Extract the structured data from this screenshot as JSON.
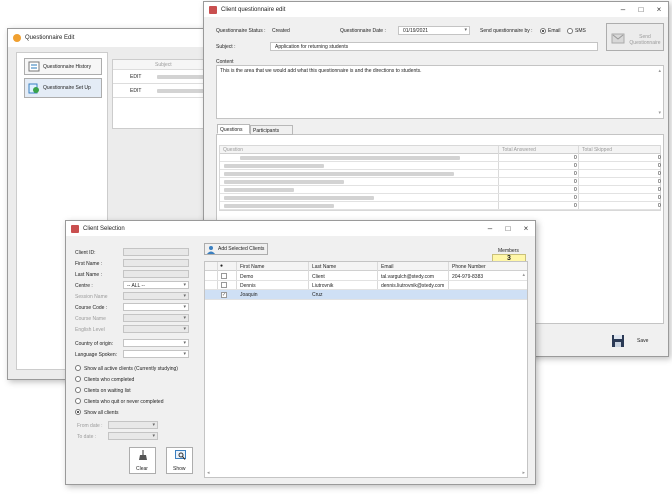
{
  "qe": {
    "title": "Questionnaire Edit",
    "nav": [
      {
        "label": "Questionnaire History"
      },
      {
        "label": "Questionnaire Set Up"
      }
    ],
    "subject_header": "Subject",
    "rows": [
      {
        "action": "EDIT"
      },
      {
        "action": "EDIT"
      }
    ]
  },
  "cqe": {
    "title": "Client questionnaire edit",
    "status_label": "Questionnaire Status :",
    "status_value": "Created",
    "date_label": "Questionnaire Date :",
    "date_value": "01/19/2021",
    "send_by_label": "Send questionnaire by :",
    "email_label": "Email",
    "sms_label": "SMS",
    "send_button": "Send Questionnaire",
    "subject_label": "Subject :",
    "subject_value": "Application for returning students",
    "content_label": "Content",
    "content_value": "This is the area that we would add what this questionnaire is and the directions to students.",
    "tabs": [
      "Questions",
      "Participants"
    ],
    "grid_headers": {
      "question": "Question",
      "answered": "Total Answered",
      "skipped": "Total Skipped"
    },
    "grid_rows": [
      {
        "answered": "0",
        "skipped": "0"
      },
      {
        "answered": "0",
        "skipped": "0"
      },
      {
        "answered": "0",
        "skipped": "0"
      },
      {
        "answered": "0",
        "skipped": "0"
      },
      {
        "answered": "0",
        "skipped": "0"
      },
      {
        "answered": "0",
        "skipped": "0"
      },
      {
        "answered": "0",
        "skipped": "0"
      }
    ],
    "save_label": "Save"
  },
  "cs": {
    "title": "Client Selection",
    "fields": {
      "client_id": "Client ID:",
      "first_name": "First Name :",
      "last_name": "Last Name :",
      "centre": "Centre :",
      "centre_value": "-- ALL --",
      "session_name": "Session Name",
      "course_code": "Course Code :",
      "course_name": "Course Name",
      "english_level": "English Level",
      "country": "Country of origin:",
      "language": "Language Spoken:"
    },
    "filters": [
      {
        "label": "Show all active clients (Currently studying)",
        "selected": false
      },
      {
        "label": "Clients who completed",
        "selected": false
      },
      {
        "label": "Clients on waiting list",
        "selected": false
      },
      {
        "label": "Clients who quit or never completed",
        "selected": false
      },
      {
        "label": "Show all clients",
        "selected": true
      }
    ],
    "from_date": "From date :",
    "to_date": "To date :",
    "clear_label": "Clear",
    "show_label": "Show",
    "add_selected": "Add Selected Clients",
    "members_label": "Members",
    "members_count": "3",
    "headers": {
      "first": "First Name",
      "last": "Last Name",
      "email": "Email",
      "phone": "Phone Number"
    },
    "clients": [
      {
        "first": "Demo",
        "last": "Client",
        "email": "tal.vargulch@stedy.com",
        "phone": "204-979-8383",
        "checked": false
      },
      {
        "first": "Dennis",
        "last": "Liutrovnik",
        "email": "dennis.liutrovnik@stedy.com",
        "phone": "",
        "checked": false
      },
      {
        "first": "Joaquin",
        "last": "Cruz",
        "email": "",
        "phone": "",
        "checked": true
      }
    ]
  }
}
